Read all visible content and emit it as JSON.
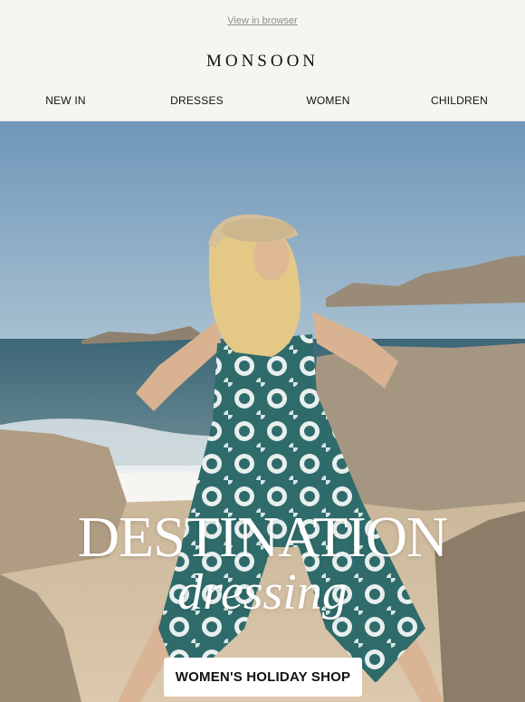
{
  "header": {
    "view_in_browser": "View in browser",
    "logo": "MONSOON",
    "nav": [
      "NEW IN",
      "DRESSES",
      "WOMEN",
      "CHILDREN"
    ]
  },
  "hero": {
    "headline": "DESTINATION",
    "subline": "dressing",
    "cta_label": "WOMEN'S HOLIDAY SHOP",
    "colors": {
      "sky": "#7fa3bf",
      "sea": "#3f6b7c",
      "sand": "#d6c3a7",
      "rock": "#a99a86",
      "dress": "#2f6b6b"
    }
  }
}
